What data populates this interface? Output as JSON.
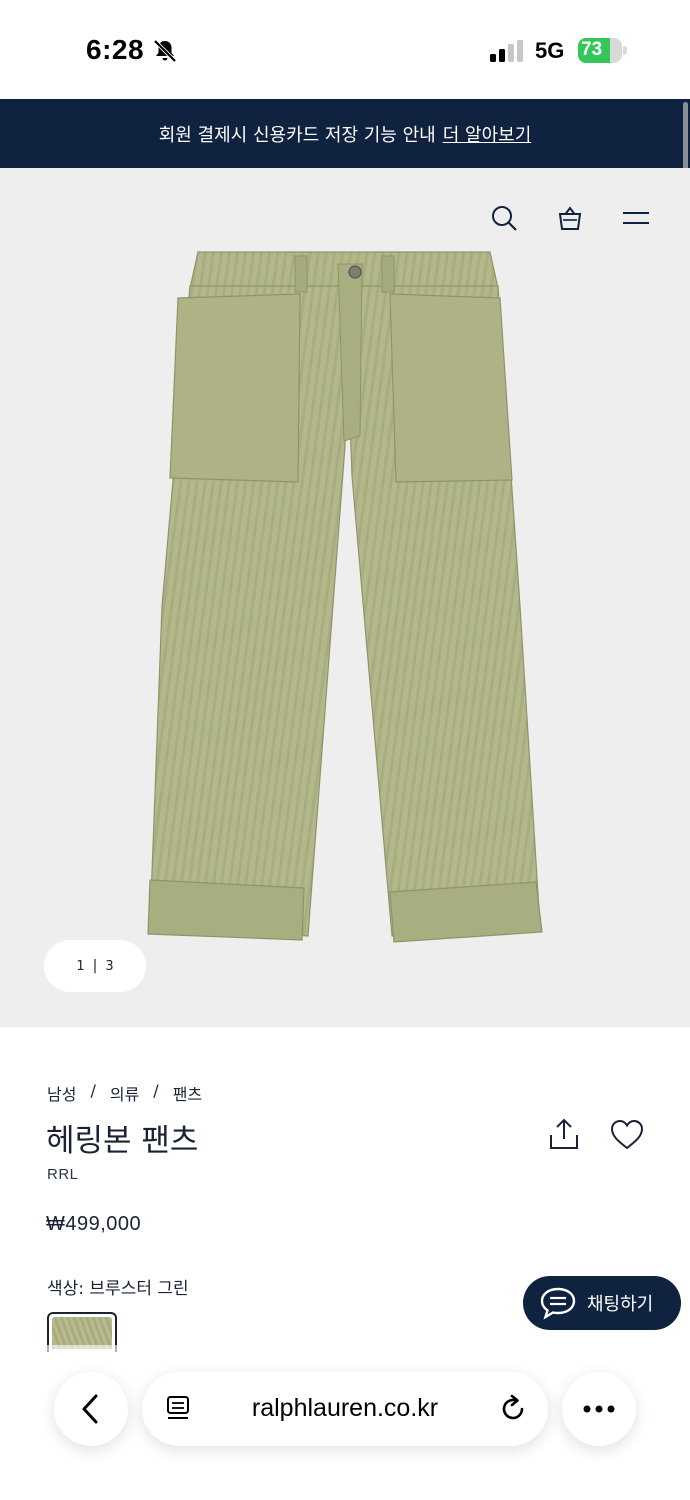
{
  "status_bar": {
    "time": "6:28",
    "network": "5G",
    "battery_percent": "73",
    "battery_level": 0.73
  },
  "banner": {
    "text": "회원 결제시 신용카드 저장 기능 안내",
    "link": "더 알아보기"
  },
  "header_icons": [
    "search-icon",
    "shopping-bag-icon",
    "menu-icon"
  ],
  "gallery": {
    "current": "1",
    "separator": "|",
    "total": "3"
  },
  "product": {
    "breadcrumb": [
      "남성",
      "의류",
      "팬츠"
    ],
    "breadcrumb_sep": "/",
    "title": "헤링본 팬츠",
    "brand": "RRL",
    "price": "₩499,000",
    "color_label": "색상: 브루스터 그린"
  },
  "chat": {
    "label": "채팅하기"
  },
  "browser": {
    "url": "ralphlauren.co.kr"
  },
  "colors": {
    "navy": "#0f2240",
    "hero_bg": "#efeeee",
    "pants_green": "#b3b78a",
    "battery_green": "#34c759"
  }
}
